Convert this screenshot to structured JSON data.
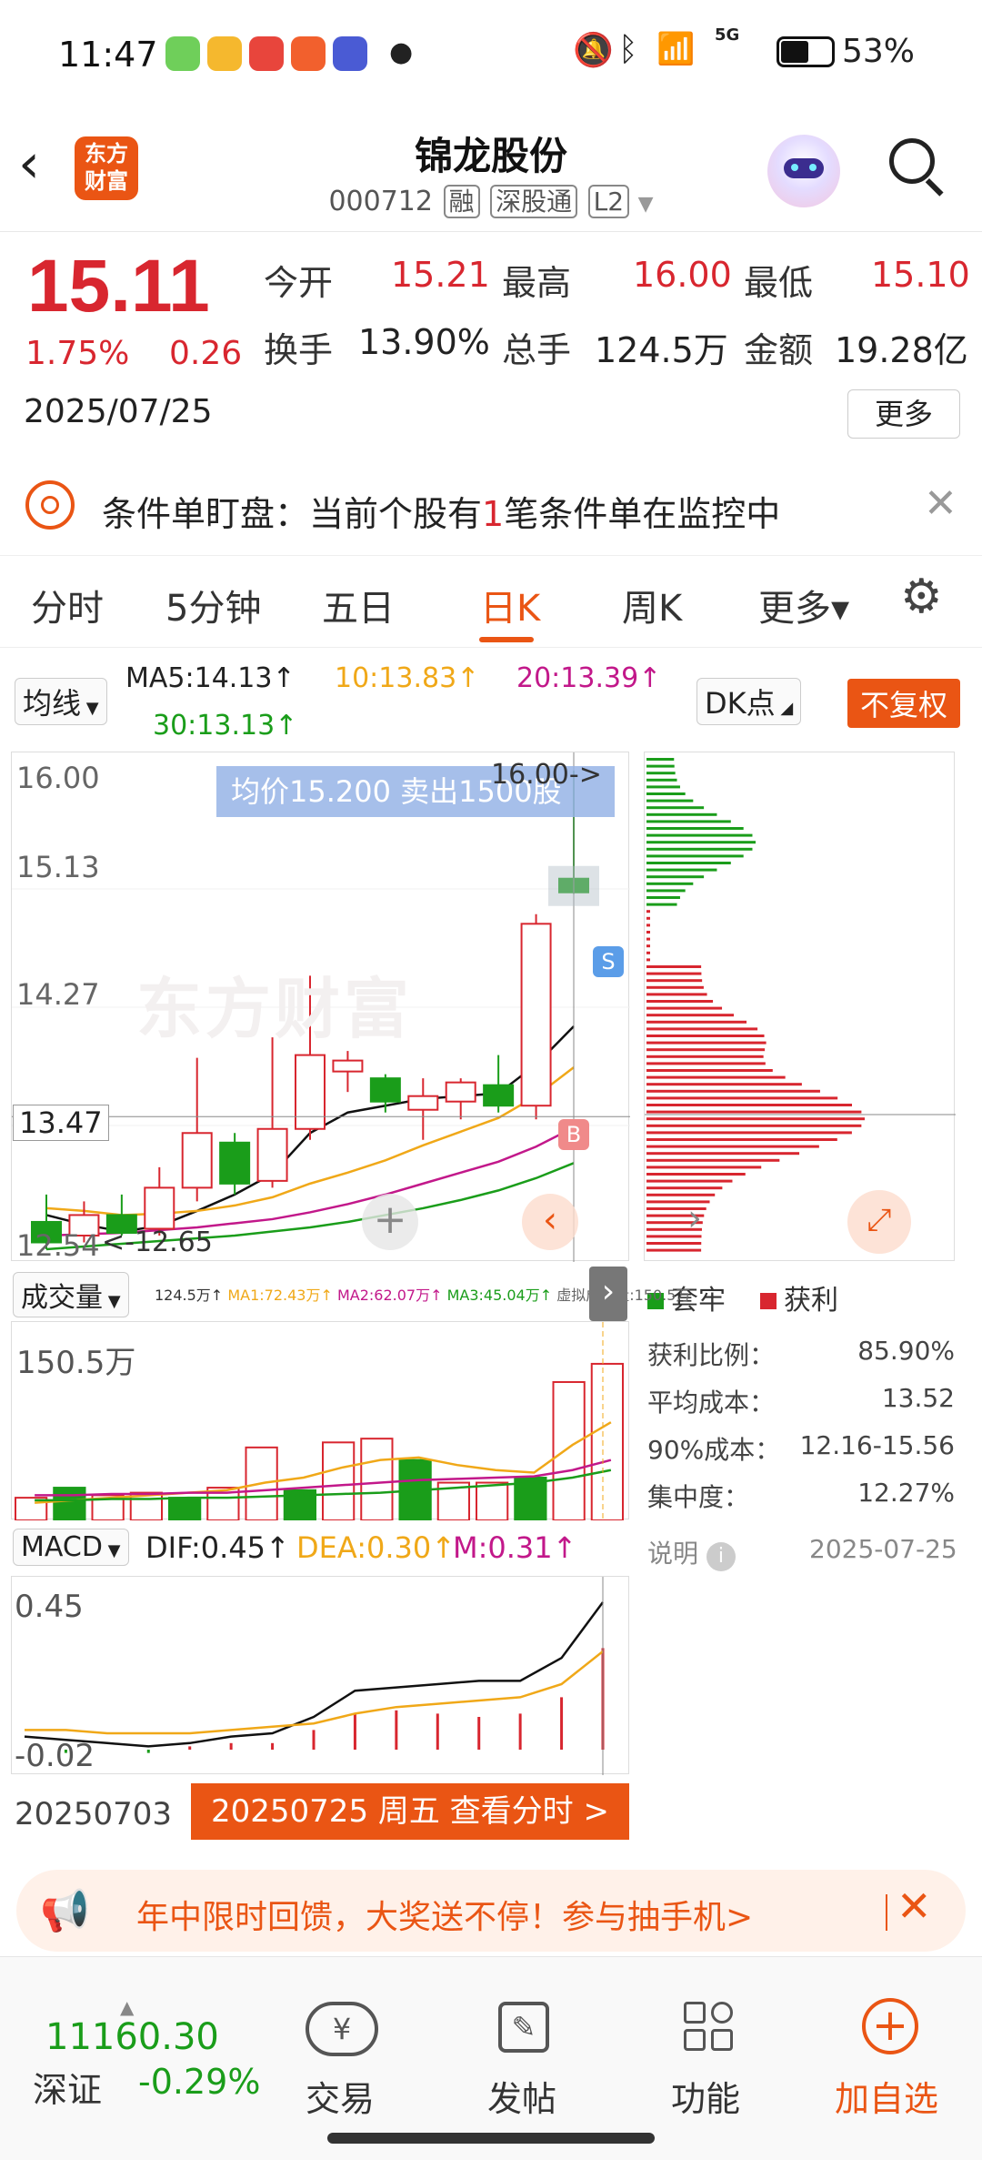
{
  "status_bar": {
    "time": "11:47",
    "battery": "53%",
    "network": "5G"
  },
  "header": {
    "logo_text_1": "东方",
    "logo_text_2": "财富",
    "stock_name": "锦龙股份",
    "stock_code": "000712",
    "tags": [
      "融",
      "深股通",
      "L2"
    ]
  },
  "quote": {
    "price": "15.11",
    "change_pct": "1.75%",
    "change_amt": "0.26",
    "date": "2025/07/25",
    "open_label": "今开",
    "open": "15.21",
    "high_label": "最高",
    "high": "16.00",
    "low_label": "最低",
    "low": "15.10",
    "turnover_label": "换手",
    "turnover": "13.90%",
    "volume_label": "总手",
    "volume": "124.5万",
    "amount_label": "金额",
    "amount": "19.28亿",
    "more": "更多"
  },
  "condition_banner": {
    "prefix": "条件单盯盘：当前个股有",
    "count": "1",
    "suffix": "笔条件单在监控中"
  },
  "tabs": [
    "分时",
    "5分钟",
    "五日",
    "日K",
    "周K",
    "更多▾"
  ],
  "active_tab": "日K",
  "ma_bar": {
    "selector": "均线",
    "ma5": "MA5:14.13↑",
    "ma10": "10:13.83↑",
    "ma20": "20:13.39↑",
    "ma30": "30:13.13↑",
    "dk": "DK点",
    "fuquan": "不复权"
  },
  "kline": {
    "tooltip": "均价15.200  卖出1500股",
    "high_mark": "16.00->",
    "low_mark": "<-12.65",
    "y_labels": [
      "16.00",
      "15.13",
      "14.27",
      "13.47",
      "12.54"
    ],
    "cursor_price": "13.47",
    "watermark": "东方财富",
    "marker_s": "S",
    "marker_b": "B"
  },
  "volume": {
    "selector": "成交量",
    "legend": [
      "124.5万↑",
      "MA1:72.43万↑",
      "MA2:62.07万↑",
      "MA3:45.04万↑",
      "虚拟成交量:150.5万"
    ],
    "max_label": "150.5万"
  },
  "macd": {
    "selector": "MACD",
    "dif": "DIF:0.45↑",
    "dea": "DEA:0.30↑",
    "m": "M:0.31↑",
    "top": "0.45",
    "bottom": "-0.02",
    "start_date": "20250703",
    "current": "20250725 周五 查看分时 >"
  },
  "chip": {
    "legend_trap": "套牢",
    "legend_profit": "获利",
    "rows": [
      {
        "label": "获利比例：",
        "value": "85.90%"
      },
      {
        "label": "平均成本：",
        "value": "13.52"
      },
      {
        "label": "90%成本：",
        "value": "12.16-15.56"
      },
      {
        "label": "集中度：",
        "value": "12.27%"
      }
    ],
    "note": "说明",
    "date": "2025-07-25"
  },
  "promo": {
    "text": "年中限时回馈，大奖送不停！参与抽手机>"
  },
  "bottom_nav": {
    "index_value": "11160.30",
    "index_name": "深证",
    "index_change": "-0.29%",
    "items": [
      "交易",
      "发帖",
      "功能",
      "加自选"
    ]
  },
  "chart_data": {
    "type": "candlestick",
    "title": "",
    "ylim": [
      12.54,
      16.0
    ],
    "candles": [
      {
        "o": 12.7,
        "c": 12.55,
        "h": 12.9,
        "l": 12.5
      },
      {
        "o": 12.6,
        "c": 12.75,
        "h": 12.85,
        "l": 12.55
      },
      {
        "o": 12.75,
        "c": 12.62,
        "h": 12.9,
        "l": 12.6
      },
      {
        "o": 12.65,
        "c": 12.95,
        "h": 13.1,
        "l": 12.6
      },
      {
        "o": 12.95,
        "c": 13.35,
        "h": 13.9,
        "l": 12.85
      },
      {
        "o": 13.28,
        "c": 12.98,
        "h": 13.35,
        "l": 12.9
      },
      {
        "o": 13.0,
        "c": 13.38,
        "h": 14.05,
        "l": 12.95
      },
      {
        "o": 13.38,
        "c": 13.92,
        "h": 14.5,
        "l": 13.3
      },
      {
        "o": 13.8,
        "c": 13.88,
        "h": 13.95,
        "l": 13.65
      },
      {
        "o": 13.75,
        "c": 13.58,
        "h": 13.78,
        "l": 13.5
      },
      {
        "o": 13.52,
        "c": 13.62,
        "h": 13.75,
        "l": 13.3
      },
      {
        "o": 13.58,
        "c": 13.72,
        "h": 13.75,
        "l": 13.45
      },
      {
        "o": 13.7,
        "c": 13.55,
        "h": 13.92,
        "l": 13.5
      },
      {
        "o": 13.55,
        "c": 14.88,
        "h": 14.95,
        "l": 13.45
      },
      {
        "o": 15.21,
        "c": 15.11,
        "h": 16.0,
        "l": 15.1
      }
    ],
    "ma_lines": {
      "MA5": [
        12.75,
        12.68,
        12.63,
        12.67,
        12.78,
        12.9,
        13.05,
        13.35,
        13.5,
        13.55,
        13.6,
        13.62,
        13.64,
        13.85,
        14.13
      ],
      "MA10": [
        12.8,
        12.78,
        12.75,
        12.76,
        12.78,
        12.82,
        12.88,
        12.98,
        13.06,
        13.15,
        13.26,
        13.36,
        13.46,
        13.62,
        13.83
      ],
      "MA20": [
        12.6,
        12.61,
        12.62,
        12.64,
        12.66,
        12.69,
        12.72,
        12.77,
        12.83,
        12.9,
        12.98,
        13.06,
        13.14,
        13.25,
        13.39
      ],
      "MA30": [
        12.5,
        12.52,
        12.54,
        12.56,
        12.58,
        12.6,
        12.63,
        12.66,
        12.7,
        12.75,
        12.8,
        12.86,
        12.93,
        13.02,
        13.13
      ]
    },
    "volumes": [
      18,
      26,
      20,
      22,
      18,
      26,
      58,
      24,
      62,
      65,
      48,
      30,
      30,
      34,
      110,
      124.5
    ],
    "macd": {
      "dif": [
        0.04,
        0.03,
        0.02,
        0.01,
        0.02,
        0.04,
        0.05,
        0.1,
        0.18,
        0.19,
        0.2,
        0.21,
        0.21,
        0.28,
        0.45
      ],
      "dea": [
        0.06,
        0.06,
        0.05,
        0.05,
        0.05,
        0.06,
        0.07,
        0.08,
        0.11,
        0.13,
        0.14,
        0.15,
        0.16,
        0.2,
        0.3
      ],
      "hist": [
        0.0,
        -0.01,
        0.0,
        -0.01,
        0.01,
        0.02,
        0.02,
        0.06,
        0.11,
        0.12,
        0.11,
        0.1,
        0.11,
        0.16,
        0.31
      ]
    }
  }
}
